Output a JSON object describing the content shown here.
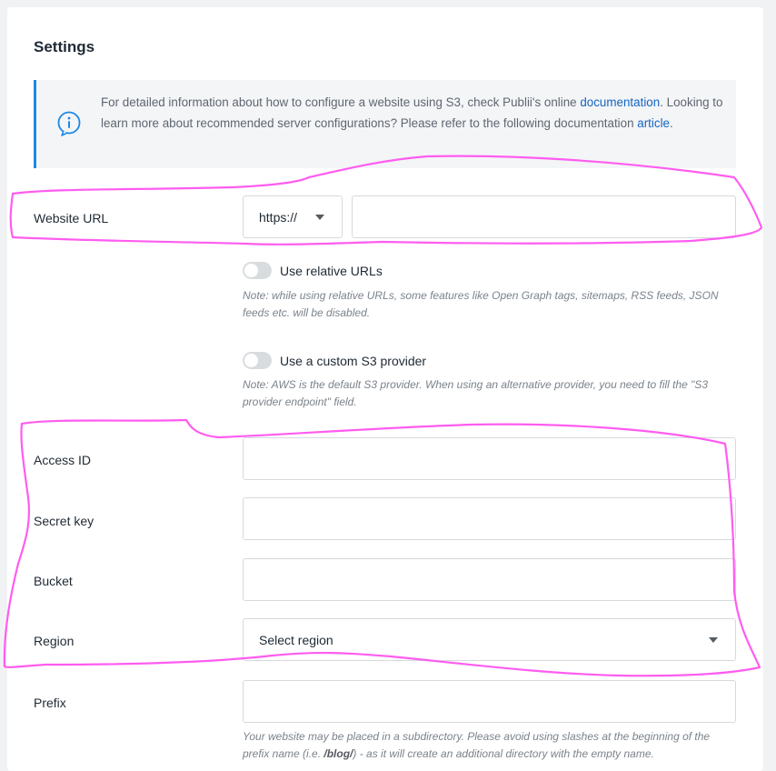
{
  "settings": {
    "title": "Settings"
  },
  "info": {
    "icon": "info-icon",
    "line1_prefix": "For detailed information about how to configure a website using S3, check Publii's online ",
    "line1_link": "documentation",
    "line1_suffix": ".",
    "line2_prefix": "Looking to learn more about recommended server configurations? Please refer to the following documentation ",
    "line2_link": "article",
    "line2_suffix": ".",
    "link_color": "#1565c0",
    "accent_color": "#1e88e5"
  },
  "website_url": {
    "label": "Website URL",
    "protocol": "https://",
    "value": "",
    "placeholder": ""
  },
  "relative_urls": {
    "label": "Use relative URLs",
    "enabled": false,
    "note": "Note: while using relative URLs, some features like Open Graph tags, sitemaps, RSS feeds, JSON feeds etc. will be disabled."
  },
  "custom_provider": {
    "label": "Use a custom S3 provider",
    "enabled": false,
    "note": "Note: AWS is the default S3 provider. When using an alternative provider, you need to fill the \"S3 provider endpoint\" field."
  },
  "access_id": {
    "label": "Access ID",
    "value": ""
  },
  "secret_key": {
    "label": "Secret key",
    "value": ""
  },
  "bucket": {
    "label": "Bucket",
    "value": ""
  },
  "region": {
    "label": "Region",
    "selected": "Select region"
  },
  "prefix": {
    "label": "Prefix",
    "value": "",
    "note_part1": "Your website may be placed in a subdirectory. Please avoid using slashes at the beginning of the prefix name (i.e. ",
    "note_bold": "/blog/",
    "note_part2": ") - as it will create an additional directory with the empty name."
  },
  "annotation_color": "#ff5cf0"
}
